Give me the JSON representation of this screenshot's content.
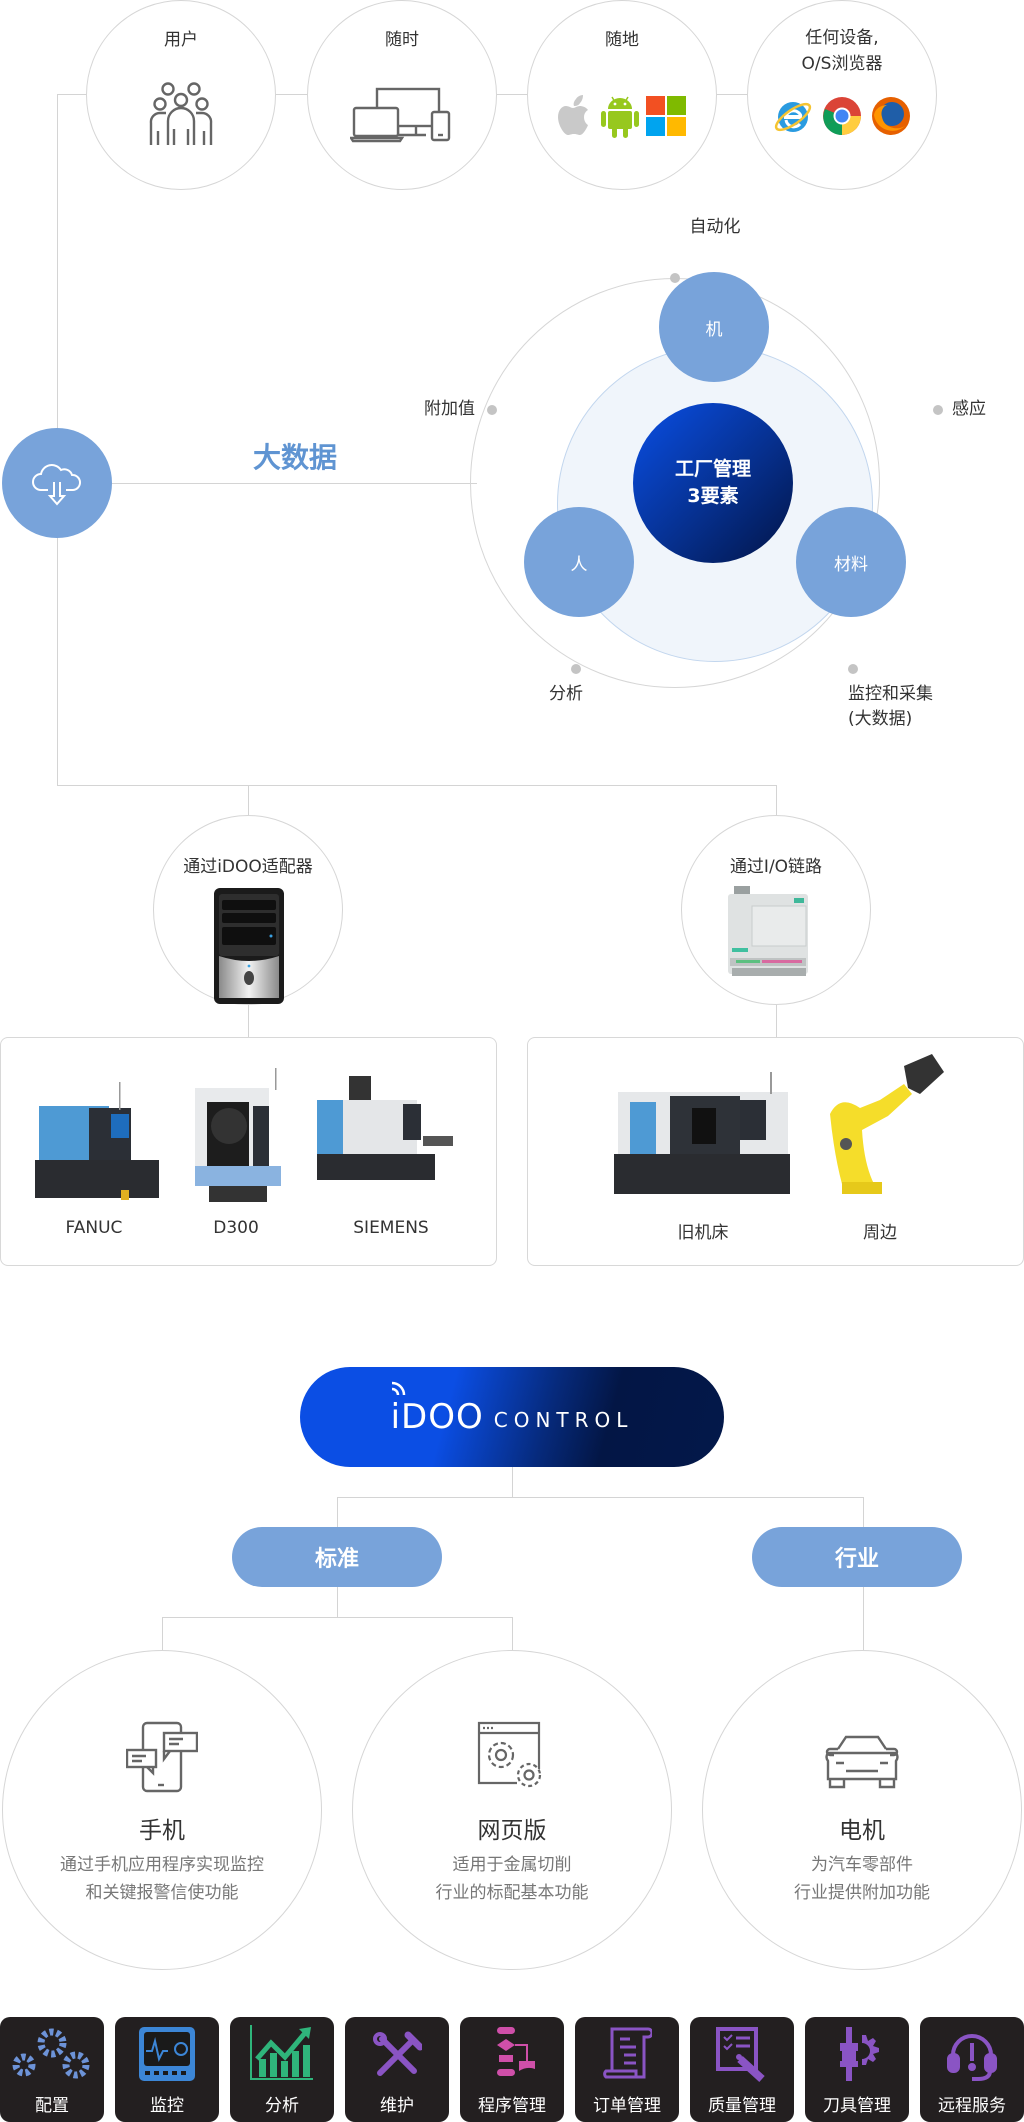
{
  "top_circles": [
    {
      "label": "用户",
      "icon": "users-group-icon"
    },
    {
      "label": "随时",
      "icon": "multi-device-icon"
    },
    {
      "label": "随地",
      "icons": [
        "apple-icon",
        "android-icon",
        "windows-icon"
      ]
    },
    {
      "label_line1": "任何设备,",
      "label_line2": "O/S浏览器",
      "icons": [
        "internet-explorer-icon",
        "chrome-icon",
        "firefox-icon"
      ]
    }
  ],
  "big_data": {
    "label": "大数据",
    "icon": "cloud-download-icon"
  },
  "factory": {
    "core_line1": "工厂管理",
    "core_line2": "3要素",
    "elements": [
      "机",
      "人",
      "材料"
    ],
    "outer_labels": {
      "top": "自动化",
      "left": "附加值",
      "right": "感应",
      "bottom_left": "分析",
      "bottom_right_line1": "监控和采集",
      "bottom_right_line2": "(大数据)"
    }
  },
  "adapters": [
    {
      "label": "通过iDOO适配器",
      "image": "pc-tower"
    },
    {
      "label": "通过I/O链路",
      "image": "io-module"
    }
  ],
  "machines_left": [
    "FANUC",
    "D300",
    "SIEMENS"
  ],
  "machines_right": [
    "旧机床",
    "周边"
  ],
  "idoo": {
    "brand": "iDOO",
    "product": "CONTROL"
  },
  "branches": [
    "标准",
    "行业"
  ],
  "features": [
    {
      "title": "手机",
      "desc_line1": "通过手机应用程序实现监控",
      "desc_line2": "和关键报警信使功能",
      "icon": "mobile-chat-icon"
    },
    {
      "title": "网页版",
      "desc_line1": "适用于金属切削",
      "desc_line2": "行业的标配基本功能",
      "icon": "web-settings-icon"
    },
    {
      "title": "电机",
      "desc_line1": "为汽车零部件",
      "desc_line2": "行业提供附加功能",
      "icon": "car-icon"
    }
  ],
  "modules": [
    {
      "label": "配置",
      "icon": "gears-icon",
      "color": "#6d93d8"
    },
    {
      "label": "监控",
      "icon": "monitor-icon",
      "color": "#3c86d6"
    },
    {
      "label": "分析",
      "icon": "chart-up-icon",
      "color": "#2fb57b"
    },
    {
      "label": "维护",
      "icon": "tools-icon",
      "color": "#8a54c4"
    },
    {
      "label": "程序管理",
      "icon": "flowchart-icon",
      "color": "#cf4fa9"
    },
    {
      "label": "订单管理",
      "icon": "scroll-icon",
      "color": "#8a54c4"
    },
    {
      "label": "质量管理",
      "icon": "quality-check-icon",
      "color": "#8a54c4"
    },
    {
      "label": "刀具管理",
      "icon": "tool-holder-icon",
      "color": "#8a54c4"
    },
    {
      "label": "远程服务",
      "icon": "headset-icon",
      "color": "#8a54c4"
    }
  ]
}
